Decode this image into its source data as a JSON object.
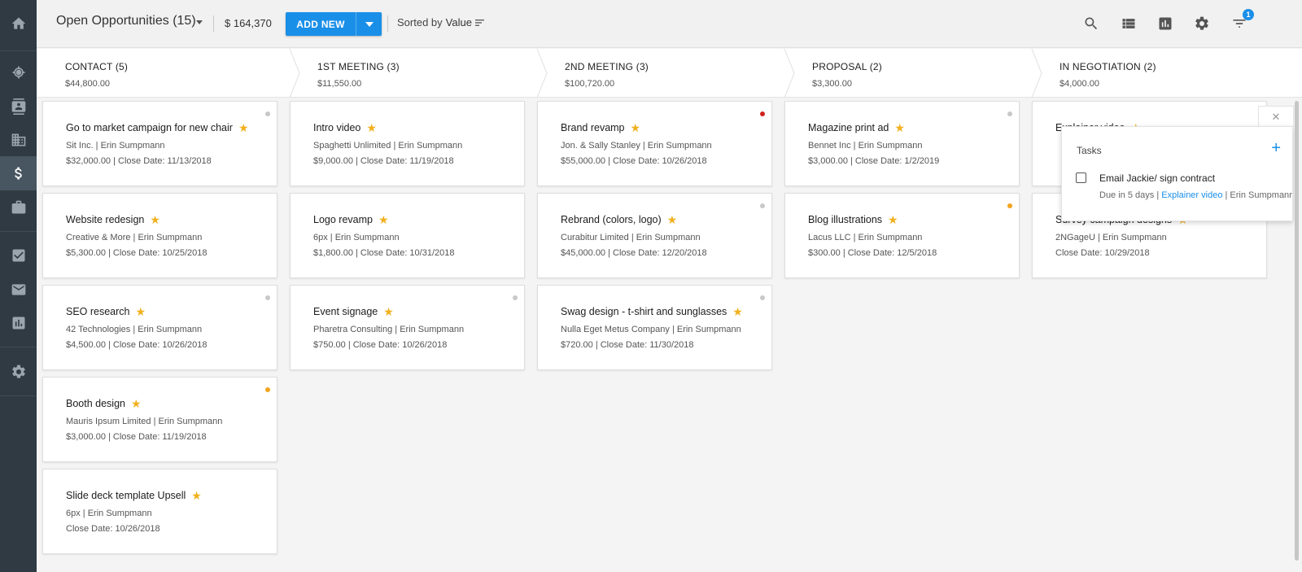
{
  "header": {
    "title": "Open Opportunities (15)",
    "total": "$ 164,370",
    "add_new_label": "ADD NEW",
    "sorted_prefix": "Sorted by",
    "sorted_field": "Value",
    "filter_count": "1",
    "accent_color": "#1a8fe8"
  },
  "nav": {
    "icons": [
      "home-icon",
      "target-icon",
      "contacts-icon",
      "company-icon",
      "dollar-icon",
      "briefcase-icon",
      "tasks-icon",
      "mail-icon",
      "reports-icon",
      "settings-icon"
    ],
    "active": "dollar-icon"
  },
  "stages": [
    {
      "name": "CONTACT (5)",
      "amount": "$44,800.00"
    },
    {
      "name": "1ST MEETING (3)",
      "amount": "$11,550.00"
    },
    {
      "name": "2ND MEETING (3)",
      "amount": "$100,720.00"
    },
    {
      "name": "PROPOSAL (2)",
      "amount": "$3,300.00"
    },
    {
      "name": "IN NEGOTIATION (2)",
      "amount": "$4,000.00"
    }
  ],
  "columns": [
    [
      {
        "title": "Go to market campaign for new chair",
        "line1": "Sit Inc. | Erin Sumpmann",
        "line2": "$32,000.00 | Close Date: 11/13/2018",
        "dot": "#c8c8c8"
      },
      {
        "title": "Website redesign",
        "line1": "Creative & More | Erin Sumpmann",
        "line2": "$5,300.00 | Close Date: 10/25/2018",
        "dot": ""
      },
      {
        "title": "SEO research",
        "line1": "42 Technologies | Erin Sumpmann",
        "line2": "$4,500.00 | Close Date: 10/26/2018",
        "dot": "#c8c8c8"
      },
      {
        "title": "Booth design",
        "line1": "Mauris Ipsum Limited | Erin Sumpmann",
        "line2": "$3,000.00 | Close Date: 11/19/2018",
        "dot": "#f2a51e"
      },
      {
        "title": "Slide deck template Upsell",
        "line1": "6px | Erin Sumpmann",
        "line2": "Close Date: 10/26/2018",
        "dot": ""
      }
    ],
    [
      {
        "title": "Intro video",
        "line1": "Spaghetti Unlimited | Erin Sumpmann",
        "line2": "$9,000.00 | Close Date: 11/19/2018",
        "dot": ""
      },
      {
        "title": "Logo revamp",
        "line1": "6px | Erin Sumpmann",
        "line2": "$1,800.00 | Close Date: 10/31/2018",
        "dot": ""
      },
      {
        "title": "Event signage",
        "line1": "Pharetra Consulting | Erin Sumpmann",
        "line2": "$750.00 | Close Date: 10/26/2018",
        "dot": "#c8c8c8"
      }
    ],
    [
      {
        "title": "Brand revamp",
        "line1": "Jon. & Sally Stanley | Erin Sumpmann",
        "line2": "$55,000.00 | Close Date: 10/26/2018",
        "dot": "#d0231e"
      },
      {
        "title": "Rebrand (colors, logo)",
        "line1": "Curabitur Limited | Erin Sumpmann",
        "line2": "$45,000.00 | Close Date: 12/20/2018",
        "dot": "#c8c8c8"
      },
      {
        "title": "Swag design - t-shirt and sunglasses",
        "line1": "Nulla Eget Metus Company | Erin Sumpmann",
        "line2": "$720.00 | Close Date: 11/30/2018",
        "dot": "#c8c8c8"
      }
    ],
    [
      {
        "title": "Magazine print ad",
        "line1": "Bennet Inc | Erin Sumpmann",
        "line2": "$3,000.00 | Close Date: 1/2/2019",
        "dot": "#c8c8c8"
      },
      {
        "title": "Blog illustrations",
        "line1": "Lacus LLC | Erin Sumpmann",
        "line2": "$300.00 | Close Date: 12/5/2018",
        "dot": "#f2a51e"
      }
    ],
    [
      {
        "title": "Explainer video",
        "line1": "",
        "line2": "",
        "dot": ""
      },
      {
        "title": "Survey campaign designs",
        "line1": "2NGageU | Erin Sumpmann",
        "line2": "Close Date: 10/29/2018",
        "dot": ""
      }
    ]
  ],
  "tasks_popover": {
    "heading": "Tasks",
    "task_title": "Email Jackie/ sign contract",
    "due": "Due in 5 days | ",
    "link": "Explainer video",
    "owner": " | Erin Sumpmann"
  }
}
